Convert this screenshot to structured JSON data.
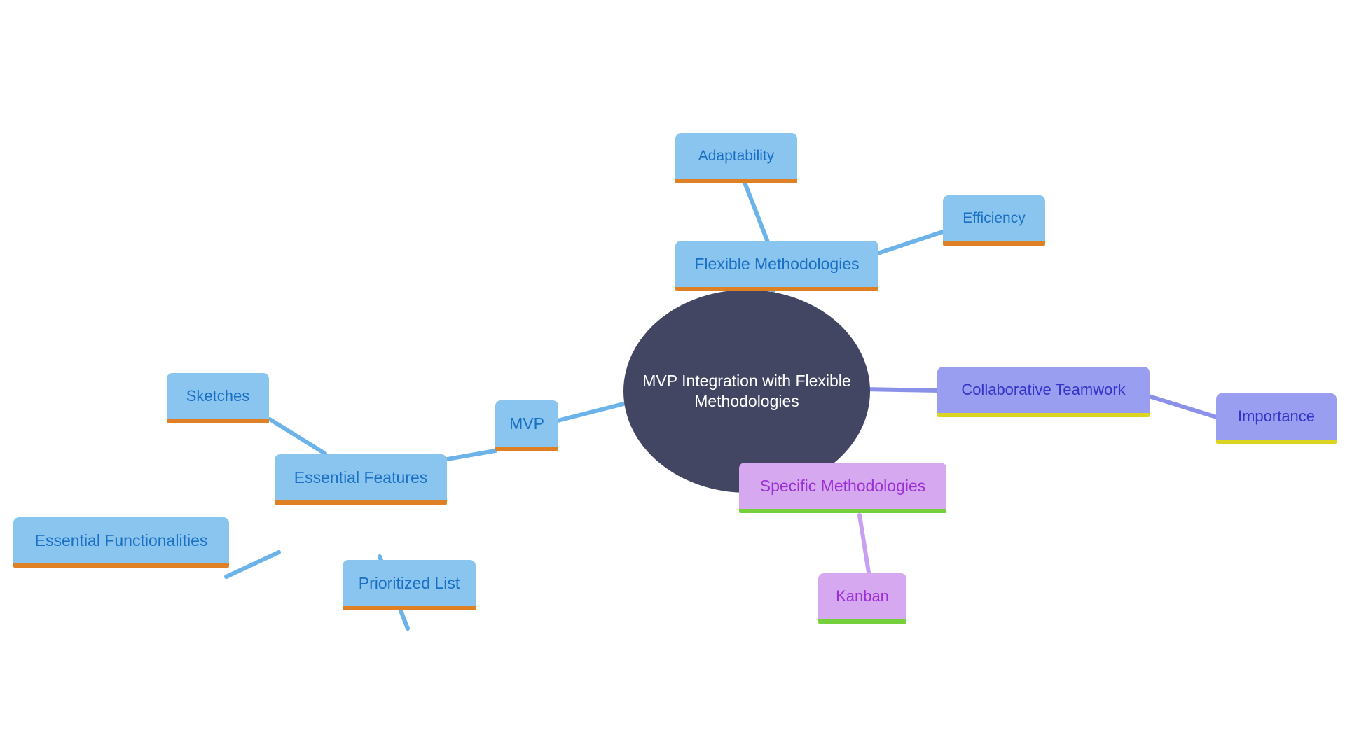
{
  "diagram": {
    "title": "MVP Integration with Flexible Methodologies",
    "type": "mind-map",
    "background_color": "#ffffff"
  },
  "palette": {
    "root_fill": "#424663",
    "root_text": "#ffffff",
    "blue_fill": "#8ac5ef",
    "blue_text": "#1a6fc4",
    "blue_underline": "#df8024",
    "blue_edge": "#6bb3e8",
    "periwinkle_fill": "#9a9ef0",
    "periwinkle_text": "#3434c9",
    "periwinkle_underline": "#dbd422",
    "periwinkle_edge": "#8b91e8",
    "orchid_fill": "#d6a8f0",
    "orchid_text": "#9b2fd6",
    "orchid_underline": "#74d13c",
    "orchid_edge": "#c9a0ef"
  },
  "nodes": {
    "root": {
      "label": "MVP Integration with Flexible Methodologies"
    },
    "adaptability": {
      "label": "Adaptability"
    },
    "flexible_methodologies": {
      "label": "Flexible Methodologies"
    },
    "efficiency": {
      "label": "Efficiency"
    },
    "collaborative_teamwork": {
      "label": "Collaborative Teamwork"
    },
    "importance": {
      "label": "Importance"
    },
    "specific_methodologies": {
      "label": "Specific Methodologies"
    },
    "kanban": {
      "label": "Kanban"
    },
    "mvp": {
      "label": "MVP"
    },
    "essential_features": {
      "label": "Essential Features"
    },
    "sketches": {
      "label": "Sketches"
    },
    "essential_functionalities": {
      "label": "Essential Functionalities"
    },
    "prioritized_list": {
      "label": "Prioritized List"
    }
  },
  "edges": [
    {
      "from": "root",
      "to": "flexible_methodologies",
      "color": "#6bb3e8"
    },
    {
      "from": "flexible_methodologies",
      "to": "adaptability",
      "color": "#6bb3e8"
    },
    {
      "from": "flexible_methodologies",
      "to": "efficiency",
      "color": "#6bb3e8"
    },
    {
      "from": "root",
      "to": "collaborative_teamwork",
      "color": "#8b91e8"
    },
    {
      "from": "collaborative_teamwork",
      "to": "importance",
      "color": "#8b91e8"
    },
    {
      "from": "root",
      "to": "specific_methodologies",
      "color": "#c9a0ef"
    },
    {
      "from": "specific_methodologies",
      "to": "kanban",
      "color": "#c9a0ef"
    },
    {
      "from": "root",
      "to": "mvp",
      "color": "#6bb3e8"
    },
    {
      "from": "mvp",
      "to": "essential_features",
      "color": "#6bb3e8"
    },
    {
      "from": "essential_features",
      "to": "sketches",
      "color": "#6bb3e8"
    },
    {
      "from": "essential_features",
      "to": "essential_functionalities",
      "color": "#6bb3e8"
    },
    {
      "from": "essential_features",
      "to": "prioritized_list",
      "color": "#6bb3e8"
    }
  ]
}
